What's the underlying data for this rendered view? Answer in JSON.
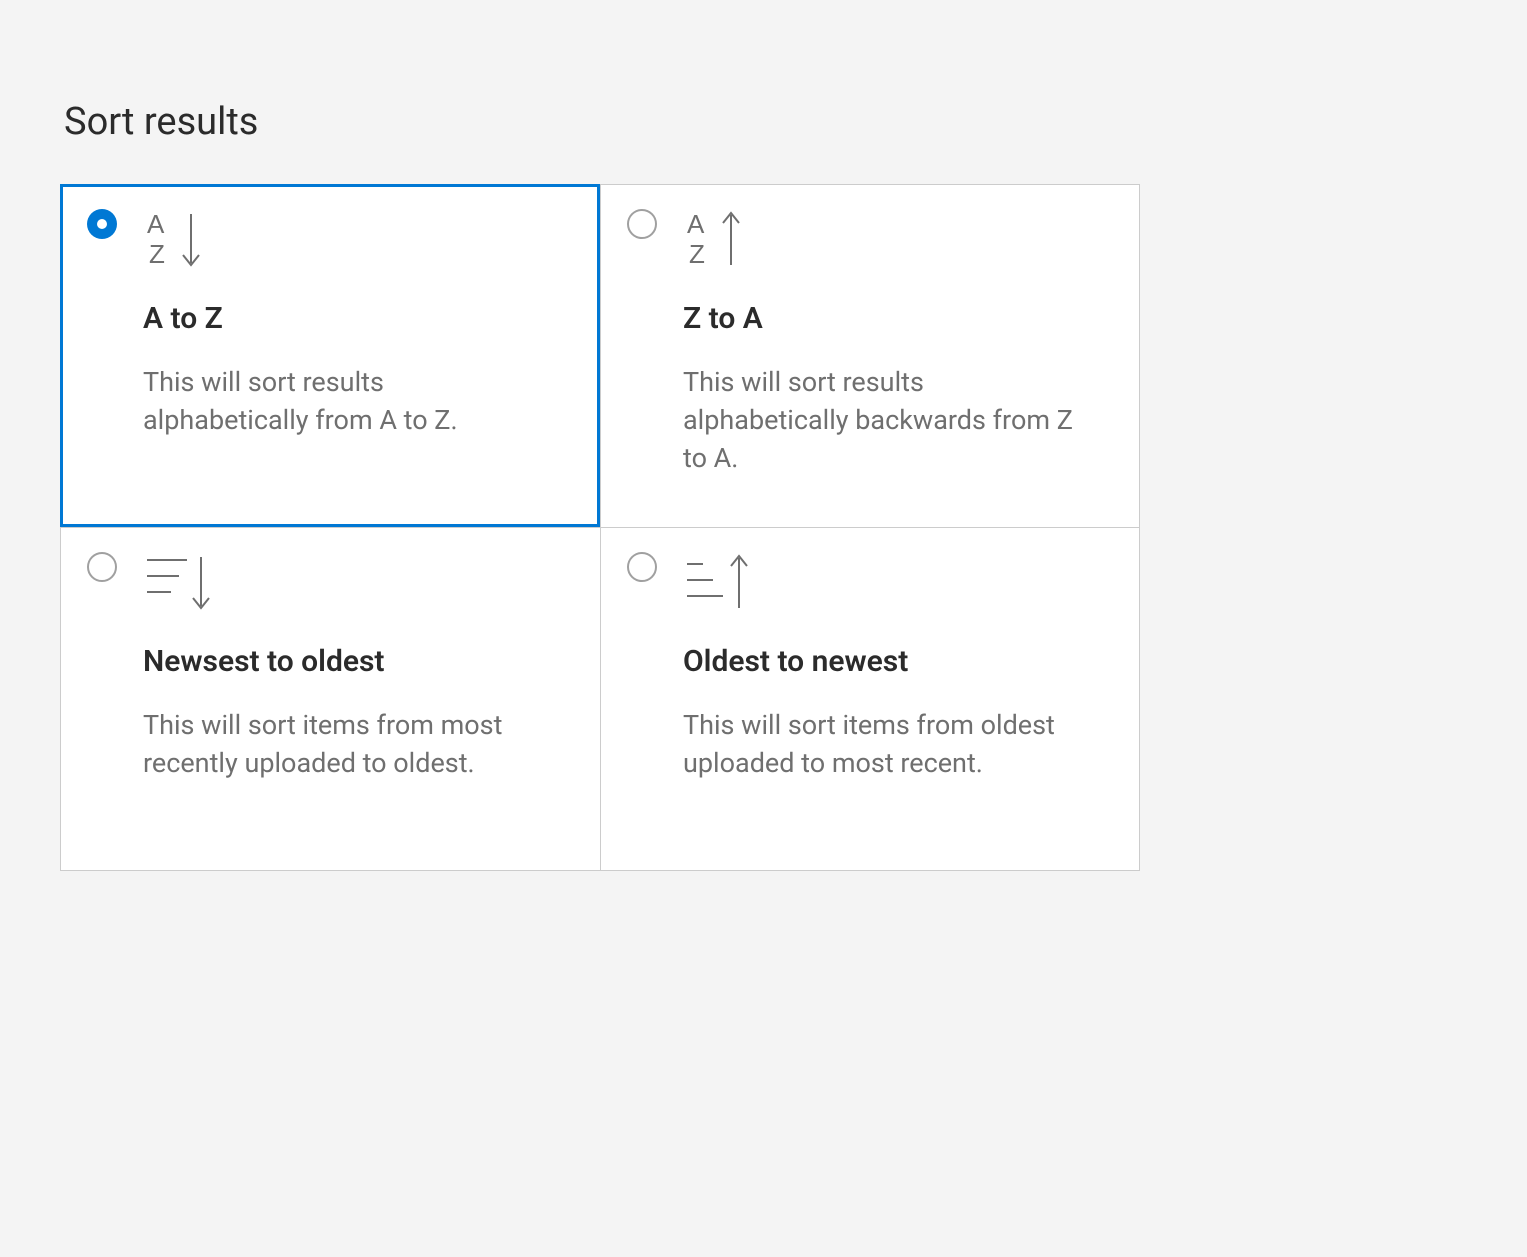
{
  "heading": "Sort results",
  "options": [
    {
      "id": "atoz",
      "label": "A to Z",
      "description": "This will sort results alphabetically from A to Z.",
      "selected": true,
      "icon": "sort-az-down"
    },
    {
      "id": "ztoa",
      "label": "Z to A",
      "description": "This will sort results alphabetically backwards from Z to A.",
      "selected": false,
      "icon": "sort-az-up"
    },
    {
      "id": "newest",
      "label": "Newsest to oldest",
      "description": "This will sort items from most recently uploaded to oldest.",
      "selected": false,
      "icon": "sort-lines-down"
    },
    {
      "id": "oldest",
      "label": "Oldest to newest",
      "description": "This will sort items from oldest uploaded to most recent.",
      "selected": false,
      "icon": "sort-lines-up"
    }
  ],
  "colors": {
    "accent": "#0078d4",
    "border": "#cccccc",
    "textPrimary": "#2b2b2b",
    "textSecondary": "#6f6f6f",
    "bg": "#f4f4f4"
  }
}
